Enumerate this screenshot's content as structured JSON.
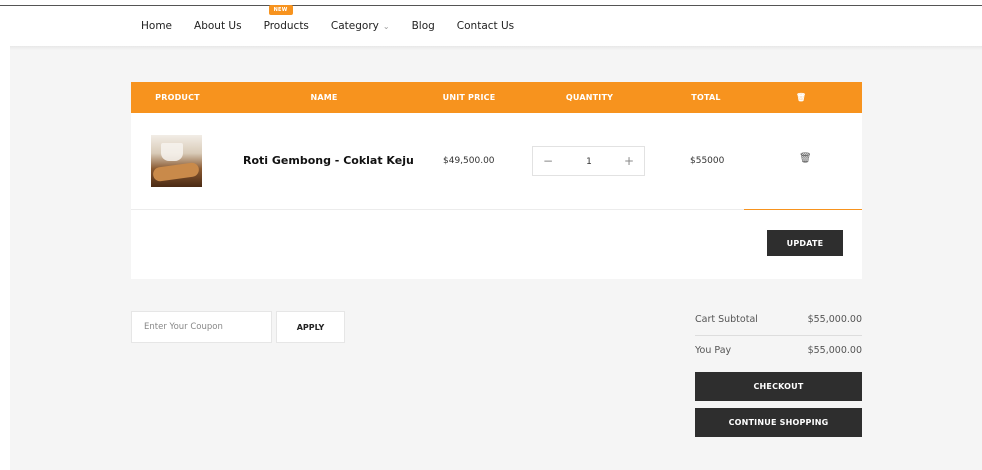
{
  "nav": {
    "items": [
      {
        "label": "Home"
      },
      {
        "label": "About Us"
      },
      {
        "label": "Products",
        "badge": "NEW"
      },
      {
        "label": "Category",
        "has_dropdown": true
      },
      {
        "label": "Blog"
      },
      {
        "label": "Contact Us"
      }
    ]
  },
  "cart": {
    "headers": [
      "PRODUCT",
      "NAME",
      "UNIT PRICE",
      "QUANTITY",
      "TOTAL"
    ],
    "header_icon": "trash-icon",
    "items": [
      {
        "name": "Roti Gembong - Coklat Keju",
        "unit_price": "$49,500.00",
        "quantity": "1",
        "total": "$55000",
        "remove_icon": "trash-icon"
      }
    ],
    "update_label": "UPDATE"
  },
  "coupon": {
    "placeholder": "Enter Your Coupon",
    "apply_label": "APPLY"
  },
  "summary": {
    "subtotal_label": "Cart Subtotal",
    "subtotal_value": "$55,000.00",
    "pay_label": "You Pay",
    "pay_value": "$55,000.00",
    "checkout_label": "CHECKOUT",
    "continue_label": "CONTINUE SHOPPING"
  },
  "colors": {
    "accent": "#f7931e",
    "dark_button": "#2e2e2e",
    "page_bg": "#f5f5f5"
  }
}
